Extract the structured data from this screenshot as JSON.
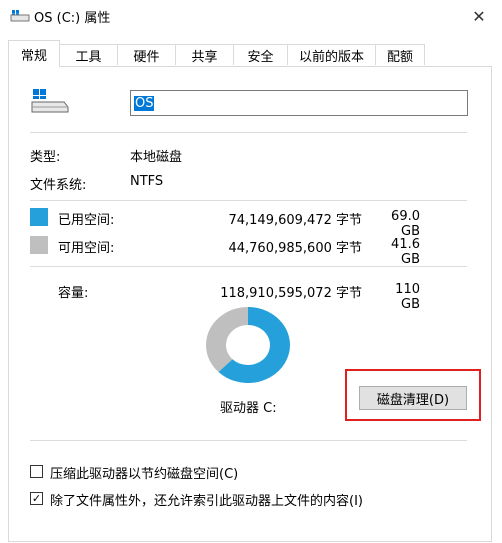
{
  "window": {
    "title": "OS (C:) 属性",
    "close_symbol": "✕"
  },
  "tabs": [
    "常规",
    "工具",
    "硬件",
    "共享",
    "安全",
    "以前的版本",
    "配额"
  ],
  "active_tab": "常规",
  "drive": {
    "name": "OS"
  },
  "info": {
    "type_label": "类型:",
    "type_value": "本地磁盘",
    "fs_label": "文件系统:",
    "fs_value": "NTFS"
  },
  "space": {
    "used_label": "已用空间:",
    "used_bytes": "74,149,609,472 字节",
    "used_gb": "69.0 GB",
    "used_color": "#26a0da",
    "free_label": "可用空间:",
    "free_bytes": "44,760,985,600 字节",
    "free_gb": "41.6 GB",
    "free_color": "#bfbfbf",
    "capacity_label": "容量:",
    "capacity_bytes": "118,910,595,072 字节",
    "capacity_gb": "110 GB",
    "used_fraction": 0.624
  },
  "drive_label": "驱动器 C:",
  "cleanup_button": "磁盘清理(D)",
  "options": {
    "compress_label": "压缩此驱动器以节约磁盘空间(C)",
    "compress_checked": false,
    "index_label": "除了文件属性外，还允许索引此驱动器上文件的内容(I)",
    "index_checked": true,
    "check_mark": "✓"
  }
}
